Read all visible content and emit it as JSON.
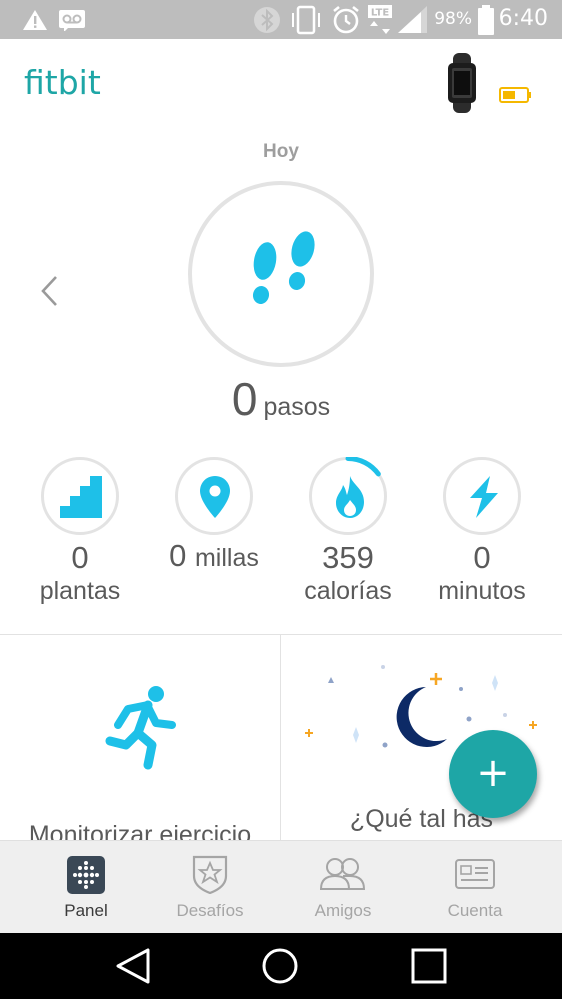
{
  "status_bar": {
    "battery_percent": "98%",
    "time": "6:40",
    "icons": [
      "warning-icon",
      "voicemail-icon",
      "bluetooth-icon",
      "vibrate-icon",
      "alarm-icon",
      "lte-icon",
      "signal-icon",
      "battery-icon"
    ]
  },
  "header": {
    "logo": "fitbit",
    "device_icon": "fitbit-band-icon",
    "device_battery_color": "#f5b800"
  },
  "dashboard": {
    "day_title": "Hoy",
    "steps": {
      "value": "0",
      "unit": "pasos"
    },
    "stats": [
      {
        "icon": "stairs-icon",
        "value": "0",
        "label": "plantas"
      },
      {
        "icon": "location-pin-icon",
        "value": "0",
        "label": "millas"
      },
      {
        "icon": "flame-icon",
        "value": "359",
        "label": "calorías",
        "progress": 0.15
      },
      {
        "icon": "bolt-icon",
        "value": "0",
        "label": "minutos"
      }
    ]
  },
  "tiles": {
    "exercise_label": "Monitorizar ejercicio",
    "sleep_label": "¿Qué tal has"
  },
  "fab": {
    "label": "+"
  },
  "bottom_nav": {
    "items": [
      {
        "label": "Panel",
        "icon": "dashboard-grid-icon",
        "active": true
      },
      {
        "label": "Desafíos",
        "icon": "badge-star-icon",
        "active": false
      },
      {
        "label": "Amigos",
        "icon": "friends-icon",
        "active": false
      },
      {
        "label": "Cuenta",
        "icon": "account-card-icon",
        "active": false
      }
    ]
  },
  "colors": {
    "accent": "#1ea6a6",
    "icon_blue": "#1ec0e8",
    "moon": "#0d2a66",
    "star_orange": "#f6a623"
  }
}
